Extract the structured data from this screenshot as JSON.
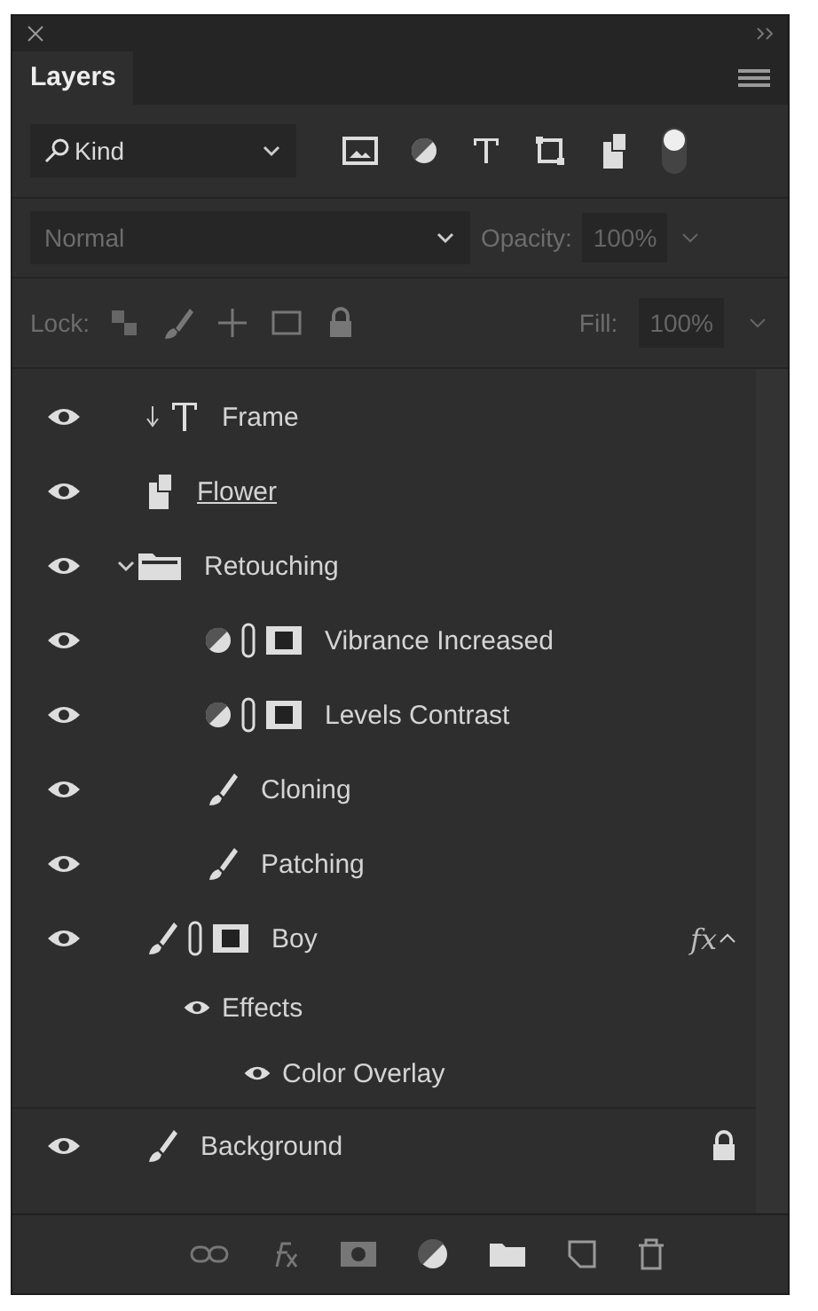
{
  "window": {
    "title": "Layers"
  },
  "filter": {
    "label": "Kind",
    "on": true
  },
  "blend": {
    "mode": "Normal",
    "opacity_label": "Opacity:",
    "opacity": "100%"
  },
  "lock": {
    "label": "Lock:",
    "fill_label": "Fill:",
    "fill": "100%"
  },
  "layers": [
    {
      "name": "Frame",
      "kind": "text",
      "visible": true
    },
    {
      "name": "Flower",
      "kind": "smart",
      "visible": true
    },
    {
      "name": "Retouching",
      "kind": "group",
      "visible": true,
      "expanded": true,
      "children": [
        {
          "name": "Vibrance Increased",
          "kind": "adjustment",
          "visible": true
        },
        {
          "name": "Levels Contrast",
          "kind": "adjustment",
          "visible": true
        },
        {
          "name": "Cloning",
          "kind": "pixel",
          "visible": true
        },
        {
          "name": "Patching",
          "kind": "pixel",
          "visible": true
        }
      ]
    },
    {
      "name": "Boy",
      "kind": "masked",
      "visible": true,
      "fx": "fx",
      "effects": {
        "label": "Effects",
        "visible": true,
        "items": [
          {
            "name": "Color Overlay",
            "visible": true
          }
        ]
      }
    },
    {
      "name": "Background",
      "kind": "pixel",
      "visible": true,
      "locked": true
    }
  ]
}
